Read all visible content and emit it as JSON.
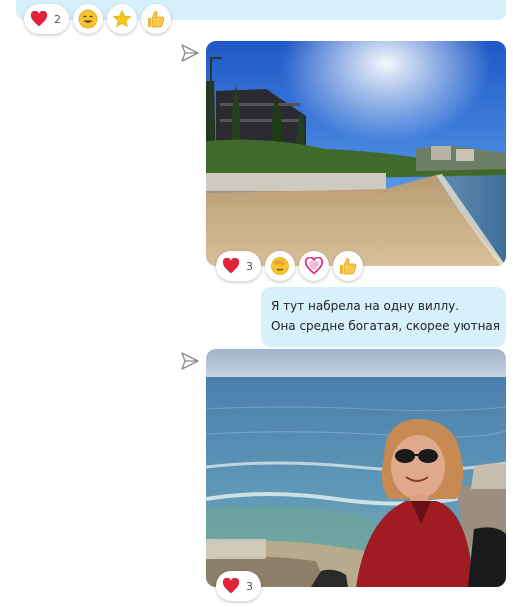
{
  "reactions_top": {
    "heart_count": "2",
    "icons": [
      "heart-icon",
      "smiley-icon",
      "star-icon",
      "thumbs-up-icon"
    ]
  },
  "photo1": {
    "reactions": {
      "heart_count": "3",
      "icons": [
        "heart-icon",
        "facepalm-emoji-icon",
        "heart-outline-icon",
        "thumbs-up-icon"
      ]
    }
  },
  "text_message": {
    "line1": "Я тут набрела на одну виллу.",
    "line2": "Она средне богатая, скорее уютная"
  },
  "photo2": {
    "reactions": {
      "heart_count": "3",
      "icons": [
        "heart-icon"
      ]
    }
  },
  "colors": {
    "bubble": "#d6f1fb",
    "heart": "#e0233a",
    "send_icon": "#8a8a8a"
  }
}
